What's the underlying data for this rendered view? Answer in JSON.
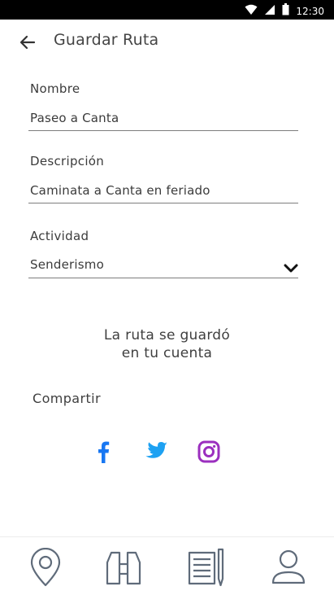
{
  "status_bar": {
    "time": "12:30",
    "icons": [
      "wifi-icon",
      "cell-signal-icon",
      "battery-icon"
    ]
  },
  "header": {
    "title": "Guardar Ruta",
    "back_icon": "arrow-left-icon"
  },
  "form": {
    "name": {
      "label": "Nombre",
      "value": "Paseo a Canta"
    },
    "description": {
      "label": "Descripción",
      "value": "Caminata a Canta en feriado"
    },
    "activity": {
      "label": "Actividad",
      "selected": "Senderismo",
      "icon": "chevron-down-icon"
    }
  },
  "confirmation": {
    "line1": "La ruta se guardó",
    "line2": "en tu cuenta"
  },
  "share": {
    "label": "Compartir",
    "networks": [
      {
        "name": "facebook-icon",
        "color": "#1877f2"
      },
      {
        "name": "twitter-icon",
        "color": "#1da1f2"
      },
      {
        "name": "instagram-icon",
        "color": "#9b2fbf"
      }
    ]
  },
  "bottom_nav": {
    "items": [
      "map-pin-icon",
      "binoculars-icon",
      "notes-icon",
      "profile-icon"
    ]
  },
  "colors": {
    "text": "#3b3b3b",
    "underline": "#7d7d7d",
    "nav_icon": "#5f6b7a"
  }
}
